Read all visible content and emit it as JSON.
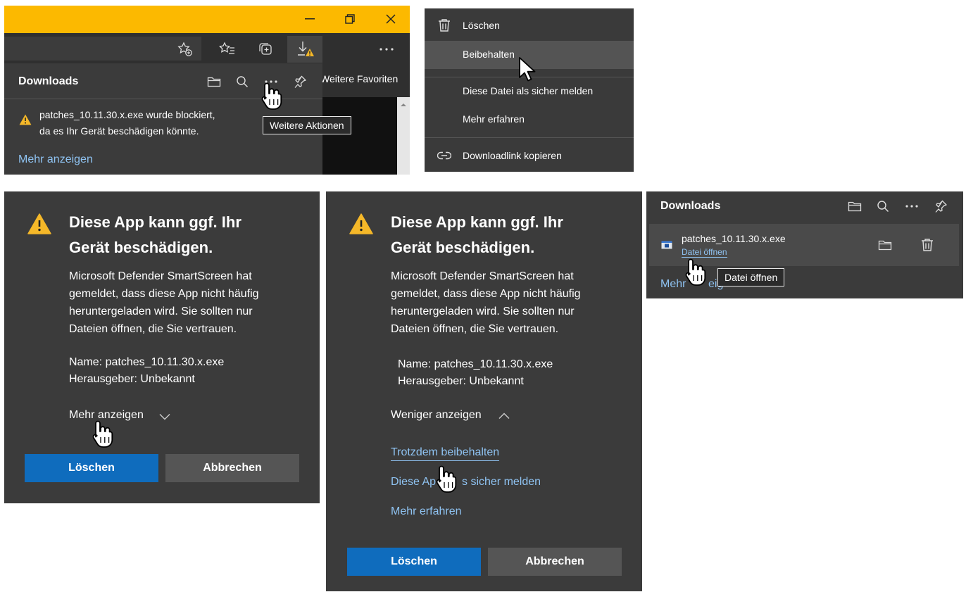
{
  "colors": {
    "titlebar_yellow": "#fcb900",
    "panel_dark": "#3b3b3b",
    "toolbar_dark": "#2f2f2f",
    "link_blue": "#8fc3f2",
    "primary_button": "#0f6cbd",
    "secondary_button": "#555555",
    "warning": "#f5b829"
  },
  "panel1": {
    "titlebar": {
      "minimize_icon": "minimize-icon",
      "restore_icon": "restore-icon",
      "close_icon": "close-icon"
    },
    "toolbar": {
      "favorites_add_icon": "star-add-icon",
      "favorites_icon": "favorites-list-icon",
      "collections_icon": "collections-icon",
      "downloads_icon": "download-warning-icon",
      "more_icon": "more-icon",
      "weitere_favoriten": "Weitere Favoriten"
    },
    "downloads": {
      "title": "Downloads",
      "line1": "patches_10.11.30.x.exe  wurde blockiert,",
      "line2": "da es Ihr Gerät beschädigen könnte.",
      "mehr_anzeigen": "Mehr anzeigen",
      "tooltip": "Weitere Aktionen"
    }
  },
  "menu": {
    "items": [
      {
        "label": "Löschen",
        "icon": "trash-icon"
      },
      {
        "label": "Beibehalten",
        "icon": ""
      },
      {
        "label": "Diese Datei als sicher melden",
        "icon": ""
      },
      {
        "label": "Mehr erfahren",
        "icon": ""
      },
      {
        "label": "Downloadlink kopieren",
        "icon": "link-icon"
      }
    ]
  },
  "dialog_collapsed": {
    "title": "Diese App kann ggf. Ihr Gerät beschädigen.",
    "body": "Microsoft Defender SmartScreen hat gemeldet, dass diese App nicht häufig heruntergeladen wird. Sie sollten nur Dateien öffnen, die Sie vertrauen.",
    "name": "Name: patches_10.11.30.x.exe",
    "publisher": "Herausgeber: Unbekannt",
    "toggle": "Mehr anzeigen",
    "delete": "Löschen",
    "cancel": "Abbrechen"
  },
  "dialog_expanded": {
    "title": "Diese App kann ggf. Ihr Gerät beschädigen.",
    "body": "Microsoft Defender SmartScreen hat gemeldet, dass diese App nicht häufig heruntergeladen wird. Sie sollten nur Dateien öffnen, die Sie vertrauen.",
    "name": "Name: patches_10.11.30.x.exe",
    "publisher": "Herausgeber: Unbekannt",
    "toggle": "Weniger anzeigen",
    "keep": "Trotzdem beibehalten",
    "report_a": "Diese Ap",
    "report_b": "s sicher melden",
    "learn": "Mehr erfahren",
    "delete": "Löschen",
    "cancel": "Abbrechen"
  },
  "panel_right": {
    "title": "Downloads",
    "filename": "patches_10.11.30.x.exe",
    "open_file": "Datei öffnen",
    "mehr_partial_a": "Mehr",
    "mehr_partial_b": "eig",
    "tooltip": "Datei öffnen"
  }
}
